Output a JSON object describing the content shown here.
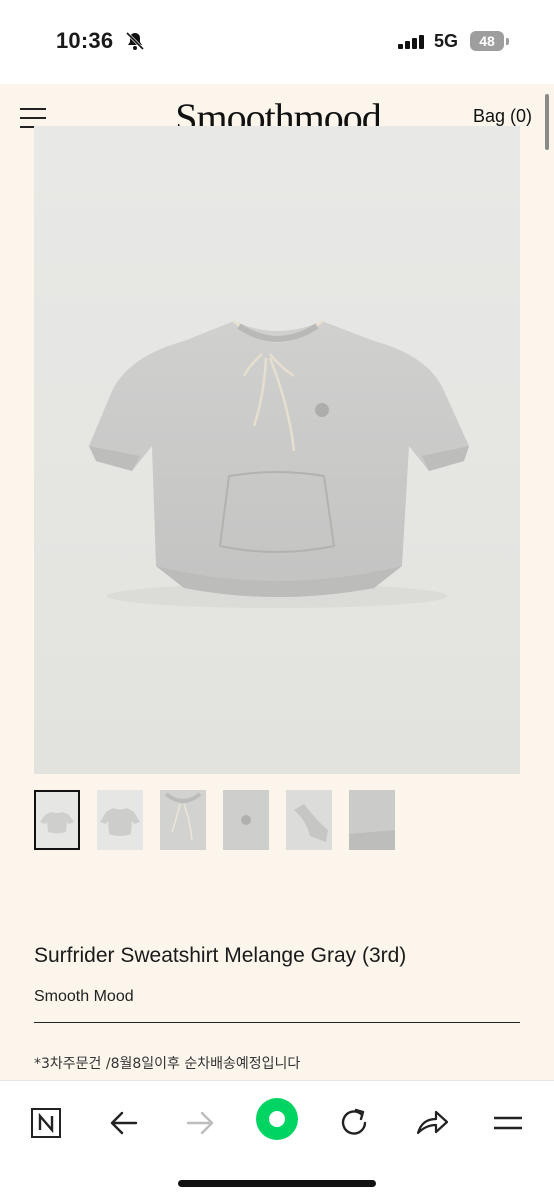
{
  "status_bar": {
    "time": "10:36",
    "network": "5G",
    "battery": "48"
  },
  "header": {
    "logo": "Smoothmood",
    "bag_label": "Bag (0)"
  },
  "product": {
    "title": "Surfrider Sweatshirt Melange Gray (3rd)",
    "brand": "Smooth Mood",
    "notice": "*3차주문건 /8월8일이후 순차배송예정입니다",
    "thumbnail_count": 6,
    "active_thumbnail": 1
  },
  "browser": {
    "buttons": [
      "naver-home",
      "back",
      "forward",
      "green-dot",
      "reload",
      "share",
      "menu"
    ]
  },
  "colors": {
    "page_bg": "#fbf5ec",
    "accent_green": "#00d564",
    "garment": "#c9c9c9"
  }
}
